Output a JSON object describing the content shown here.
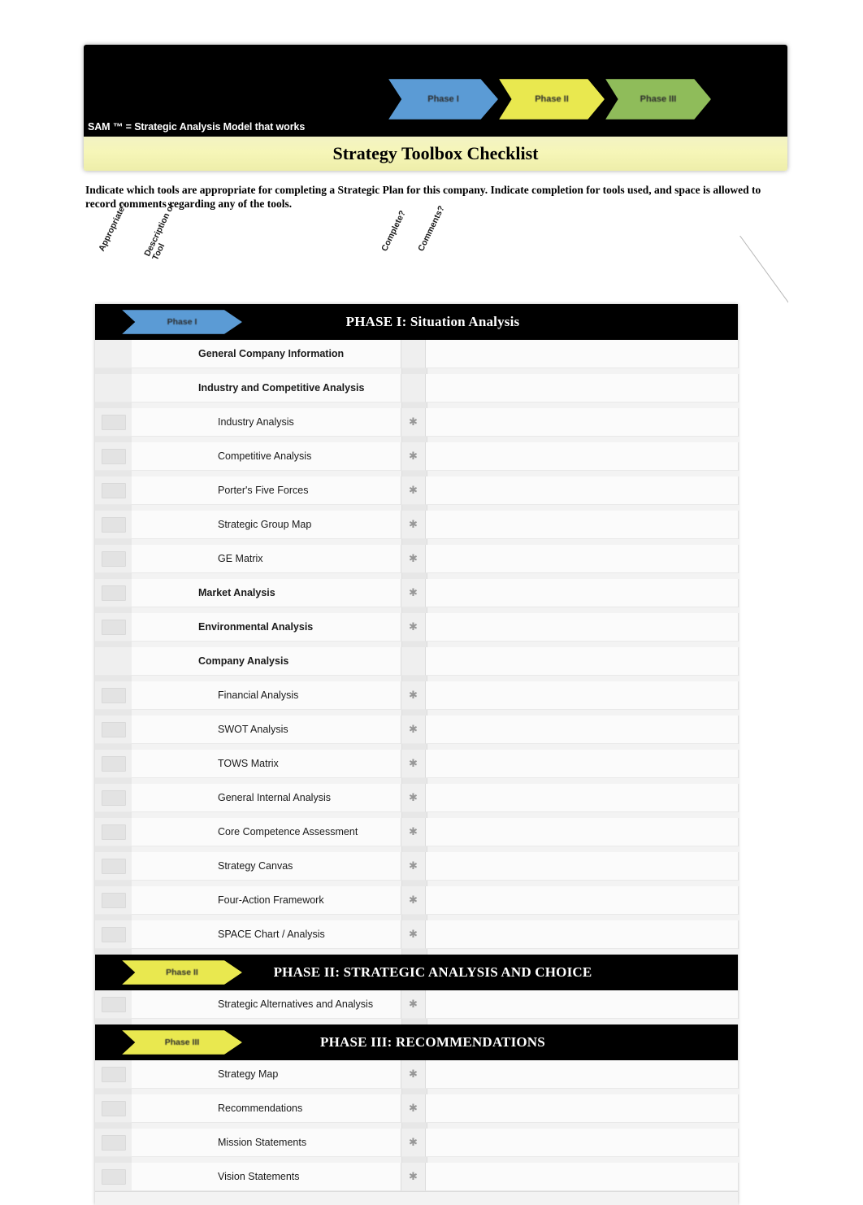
{
  "masthead": {
    "sam_tagline": "SAM ™ = Strategic Analysis Model that works",
    "title": "Strategy Toolbox Checklist",
    "chevrons": [
      {
        "label": "Phase I",
        "color": "#5b9bd5"
      },
      {
        "label": "Phase II",
        "color": "#e9e84f"
      },
      {
        "label": "Phase III",
        "color": "#8fbc5a"
      }
    ]
  },
  "intro": "Indicate which tools are appropriate for completing a Strategic Plan for this company.  Indicate completion for tools used, and space is allowed to record comments regarding any of the tools.",
  "columns": {
    "appropriate": "Appropriate?",
    "description": "Description of Tool",
    "complete": "Complete?",
    "comments": "Comments?"
  },
  "sections": [
    {
      "phase_label": "Phase I",
      "phase_color": "#5b9bd5",
      "phase_title": "PHASE I: Situation Analysis",
      "rows": [
        {
          "label": "General Company Information",
          "level": "bold",
          "complete": false,
          "appropriate": false
        },
        {
          "label": "Industry and Competitive Analysis",
          "level": "bold",
          "complete": false,
          "appropriate": false
        },
        {
          "label": "Industry Analysis",
          "level": "sub",
          "complete": true,
          "appropriate": true
        },
        {
          "label": "Competitive Analysis",
          "level": "sub",
          "complete": true,
          "appropriate": true
        },
        {
          "label": "Porter's Five Forces",
          "level": "sub",
          "complete": true,
          "appropriate": true
        },
        {
          "label": "Strategic Group  Map",
          "level": "sub",
          "complete": true,
          "appropriate": true
        },
        {
          "label": "GE Matrix",
          "level": "sub",
          "complete": true,
          "appropriate": true
        },
        {
          "label": "Market Analysis",
          "level": "bold",
          "complete": true,
          "appropriate": true
        },
        {
          "label": "Environmental Analysis",
          "level": "bold",
          "complete": true,
          "appropriate": true
        },
        {
          "label": "Company Analysis",
          "level": "bold",
          "complete": false,
          "appropriate": false
        },
        {
          "label": "Financial Analysis",
          "level": "sub",
          "complete": true,
          "appropriate": true
        },
        {
          "label": "SWOT Analysis",
          "level": "sub",
          "complete": true,
          "appropriate": true
        },
        {
          "label": "TOWS Matrix",
          "level": "sub",
          "complete": true,
          "appropriate": true
        },
        {
          "label": "General Internal Analysis",
          "level": "sub",
          "complete": true,
          "appropriate": true
        },
        {
          "label": "Core Competence Assessment",
          "level": "sub",
          "complete": true,
          "appropriate": true
        },
        {
          "label": "Strategy Canvas",
          "level": "sub",
          "complete": true,
          "appropriate": true
        },
        {
          "label": "Four-Action Framework",
          "level": "sub",
          "complete": true,
          "appropriate": true
        },
        {
          "label": "SPACE Chart / Analysis",
          "level": "sub",
          "complete": true,
          "appropriate": true
        }
      ]
    },
    {
      "phase_label": "Phase II",
      "phase_color": "#e9e84f",
      "phase_title": "PHASE II:  STRATEGIC ANALYSIS AND CHOICE",
      "rows": [
        {
          "label": "Strategic Alternatives and Analysis",
          "level": "sub",
          "complete": true,
          "appropriate": true
        }
      ]
    },
    {
      "phase_label": "Phase III",
      "phase_color": "#e9e84f",
      "phase_title": "PHASE III:  RECOMMENDATIONS",
      "rows": [
        {
          "label": "Strategy Map",
          "level": "sub",
          "complete": true,
          "appropriate": true
        },
        {
          "label": "Recommendations",
          "level": "sub",
          "complete": true,
          "appropriate": true
        },
        {
          "label": "Mission Statements",
          "level": "sub",
          "complete": true,
          "appropriate": true
        },
        {
          "label": "Vision Statements",
          "level": "sub",
          "complete": true,
          "appropriate": true
        }
      ]
    }
  ]
}
